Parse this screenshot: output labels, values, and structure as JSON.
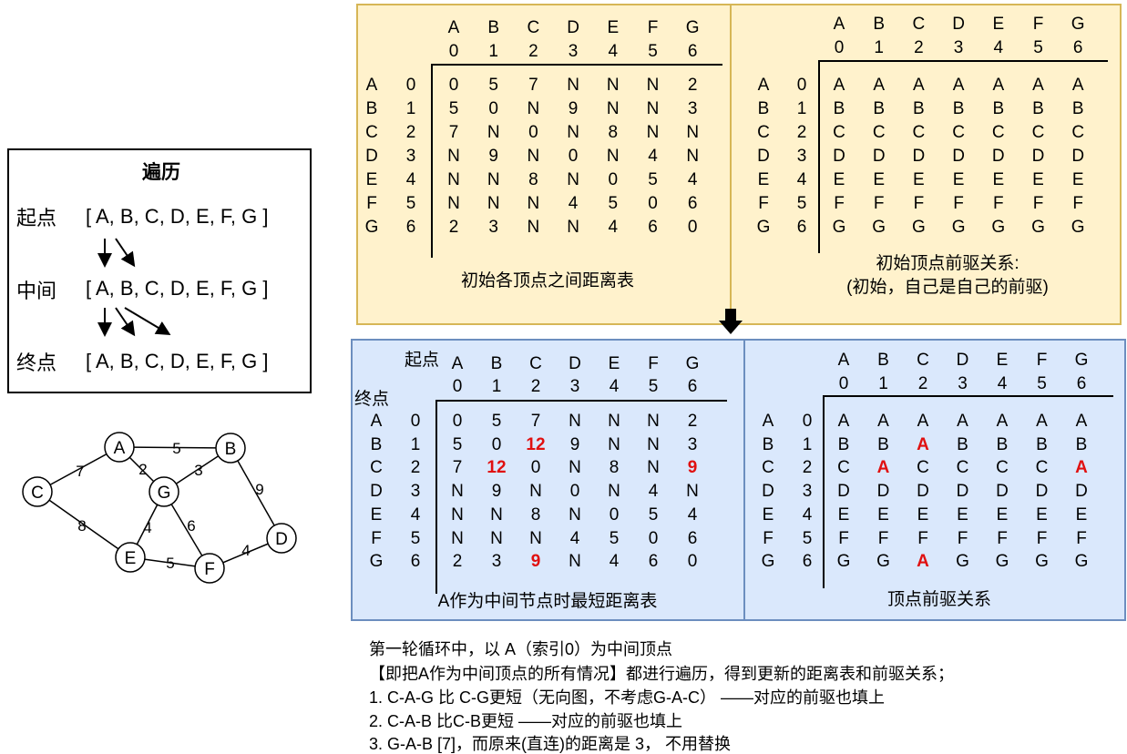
{
  "legend": {
    "title": "遍历",
    "rows": [
      {
        "label": "起点",
        "list": "[ A, B, C, D, E, F, G ]"
      },
      {
        "label": "中间",
        "list": "[ A, B, C, D, E, F, G ]"
      },
      {
        "label": "终点",
        "list": "[ A, B, C, D, E, F, G ]"
      }
    ]
  },
  "graph": {
    "nodes": [
      "A",
      "B",
      "C",
      "D",
      "E",
      "F",
      "G"
    ],
    "edges": [
      {
        "from": "A",
        "to": "B",
        "weight": "5"
      },
      {
        "from": "A",
        "to": "C",
        "weight": "7"
      },
      {
        "from": "A",
        "to": "G",
        "weight": "2"
      },
      {
        "from": "B",
        "to": "G",
        "weight": "3"
      },
      {
        "from": "B",
        "to": "D",
        "weight": "9"
      },
      {
        "from": "C",
        "to": "E",
        "weight": "8"
      },
      {
        "from": "G",
        "to": "E",
        "weight": "4"
      },
      {
        "from": "G",
        "to": "F",
        "weight": "6"
      },
      {
        "from": "E",
        "to": "F",
        "weight": "5"
      },
      {
        "from": "F",
        "to": "D",
        "weight": "4"
      }
    ]
  },
  "vertex_letters": [
    "A",
    "B",
    "C",
    "D",
    "E",
    "F",
    "G"
  ],
  "vertex_indices": [
    "0",
    "1",
    "2",
    "3",
    "4",
    "5",
    "6"
  ],
  "tables": {
    "init_dist": {
      "caption": "初始各顶点之间距离表",
      "rows": [
        [
          "0",
          "5",
          "7",
          "N",
          "N",
          "N",
          "2"
        ],
        [
          "5",
          "0",
          "N",
          "9",
          "N",
          "N",
          "3"
        ],
        [
          "7",
          "N",
          "0",
          "N",
          "8",
          "N",
          "N"
        ],
        [
          "N",
          "9",
          "N",
          "0",
          "N",
          "4",
          "N"
        ],
        [
          "N",
          "N",
          "8",
          "N",
          "0",
          "5",
          "4"
        ],
        [
          "N",
          "N",
          "N",
          "4",
          "5",
          "0",
          "6"
        ],
        [
          "2",
          "3",
          "N",
          "N",
          "4",
          "6",
          "0"
        ]
      ]
    },
    "init_pre": {
      "caption_line1": "初始顶点前驱关系:",
      "caption_line2": "(初始，自己是自己的前驱)",
      "rows": [
        [
          "A",
          "A",
          "A",
          "A",
          "A",
          "A",
          "A"
        ],
        [
          "B",
          "B",
          "B",
          "B",
          "B",
          "B",
          "B"
        ],
        [
          "C",
          "C",
          "C",
          "C",
          "C",
          "C",
          "C"
        ],
        [
          "D",
          "D",
          "D",
          "D",
          "D",
          "D",
          "D"
        ],
        [
          "E",
          "E",
          "E",
          "E",
          "E",
          "E",
          "E"
        ],
        [
          "F",
          "F",
          "F",
          "F",
          "F",
          "F",
          "F"
        ],
        [
          "G",
          "G",
          "G",
          "G",
          "G",
          "G",
          "G"
        ]
      ]
    },
    "a_dist": {
      "caption": "A作为中间节点时最短距离表",
      "start_label": "起点",
      "end_label": "终点",
      "rows": [
        [
          "0",
          "5",
          "7",
          "N",
          "N",
          "N",
          "2"
        ],
        [
          "5",
          "0",
          "12",
          "9",
          "N",
          "N",
          "3"
        ],
        [
          "7",
          "12",
          "0",
          "N",
          "8",
          "N",
          "9"
        ],
        [
          "N",
          "9",
          "N",
          "0",
          "N",
          "4",
          "N"
        ],
        [
          "N",
          "N",
          "8",
          "N",
          "0",
          "5",
          "4"
        ],
        [
          "N",
          "N",
          "N",
          "4",
          "5",
          "0",
          "6"
        ],
        [
          "2",
          "3",
          "9",
          "N",
          "4",
          "6",
          "0"
        ]
      ],
      "highlight": [
        [
          1,
          2
        ],
        [
          2,
          1
        ],
        [
          2,
          6
        ],
        [
          6,
          2
        ]
      ]
    },
    "a_pre": {
      "caption": "顶点前驱关系",
      "rows": [
        [
          "A",
          "A",
          "A",
          "A",
          "A",
          "A",
          "A"
        ],
        [
          "B",
          "B",
          "A",
          "B",
          "B",
          "B",
          "B"
        ],
        [
          "C",
          "A",
          "C",
          "C",
          "C",
          "C",
          "A"
        ],
        [
          "D",
          "D",
          "D",
          "D",
          "D",
          "D",
          "D"
        ],
        [
          "E",
          "E",
          "E",
          "E",
          "E",
          "E",
          "E"
        ],
        [
          "F",
          "F",
          "F",
          "F",
          "F",
          "F",
          "F"
        ],
        [
          "G",
          "G",
          "A",
          "G",
          "G",
          "G",
          "G"
        ]
      ],
      "highlight": [
        [
          1,
          2
        ],
        [
          2,
          1
        ],
        [
          2,
          6
        ],
        [
          6,
          2
        ]
      ]
    }
  },
  "notes": [
    "第一轮循环中，以 A（索引0）为中间顶点",
    "【即把A作为中间顶点的所有情况】都进行遍历，得到更新的距离表和前驱关系；",
    "1. C-A-G 比 C-G更短（无向图，不考虑G-A-C） ——对应的前驱也填上",
    "2. C-A-B 比C-B更短    ——对应的前驱也填上",
    "3. G-A-B [7]，而原来(直连)的距离是 3， 不用替换"
  ]
}
